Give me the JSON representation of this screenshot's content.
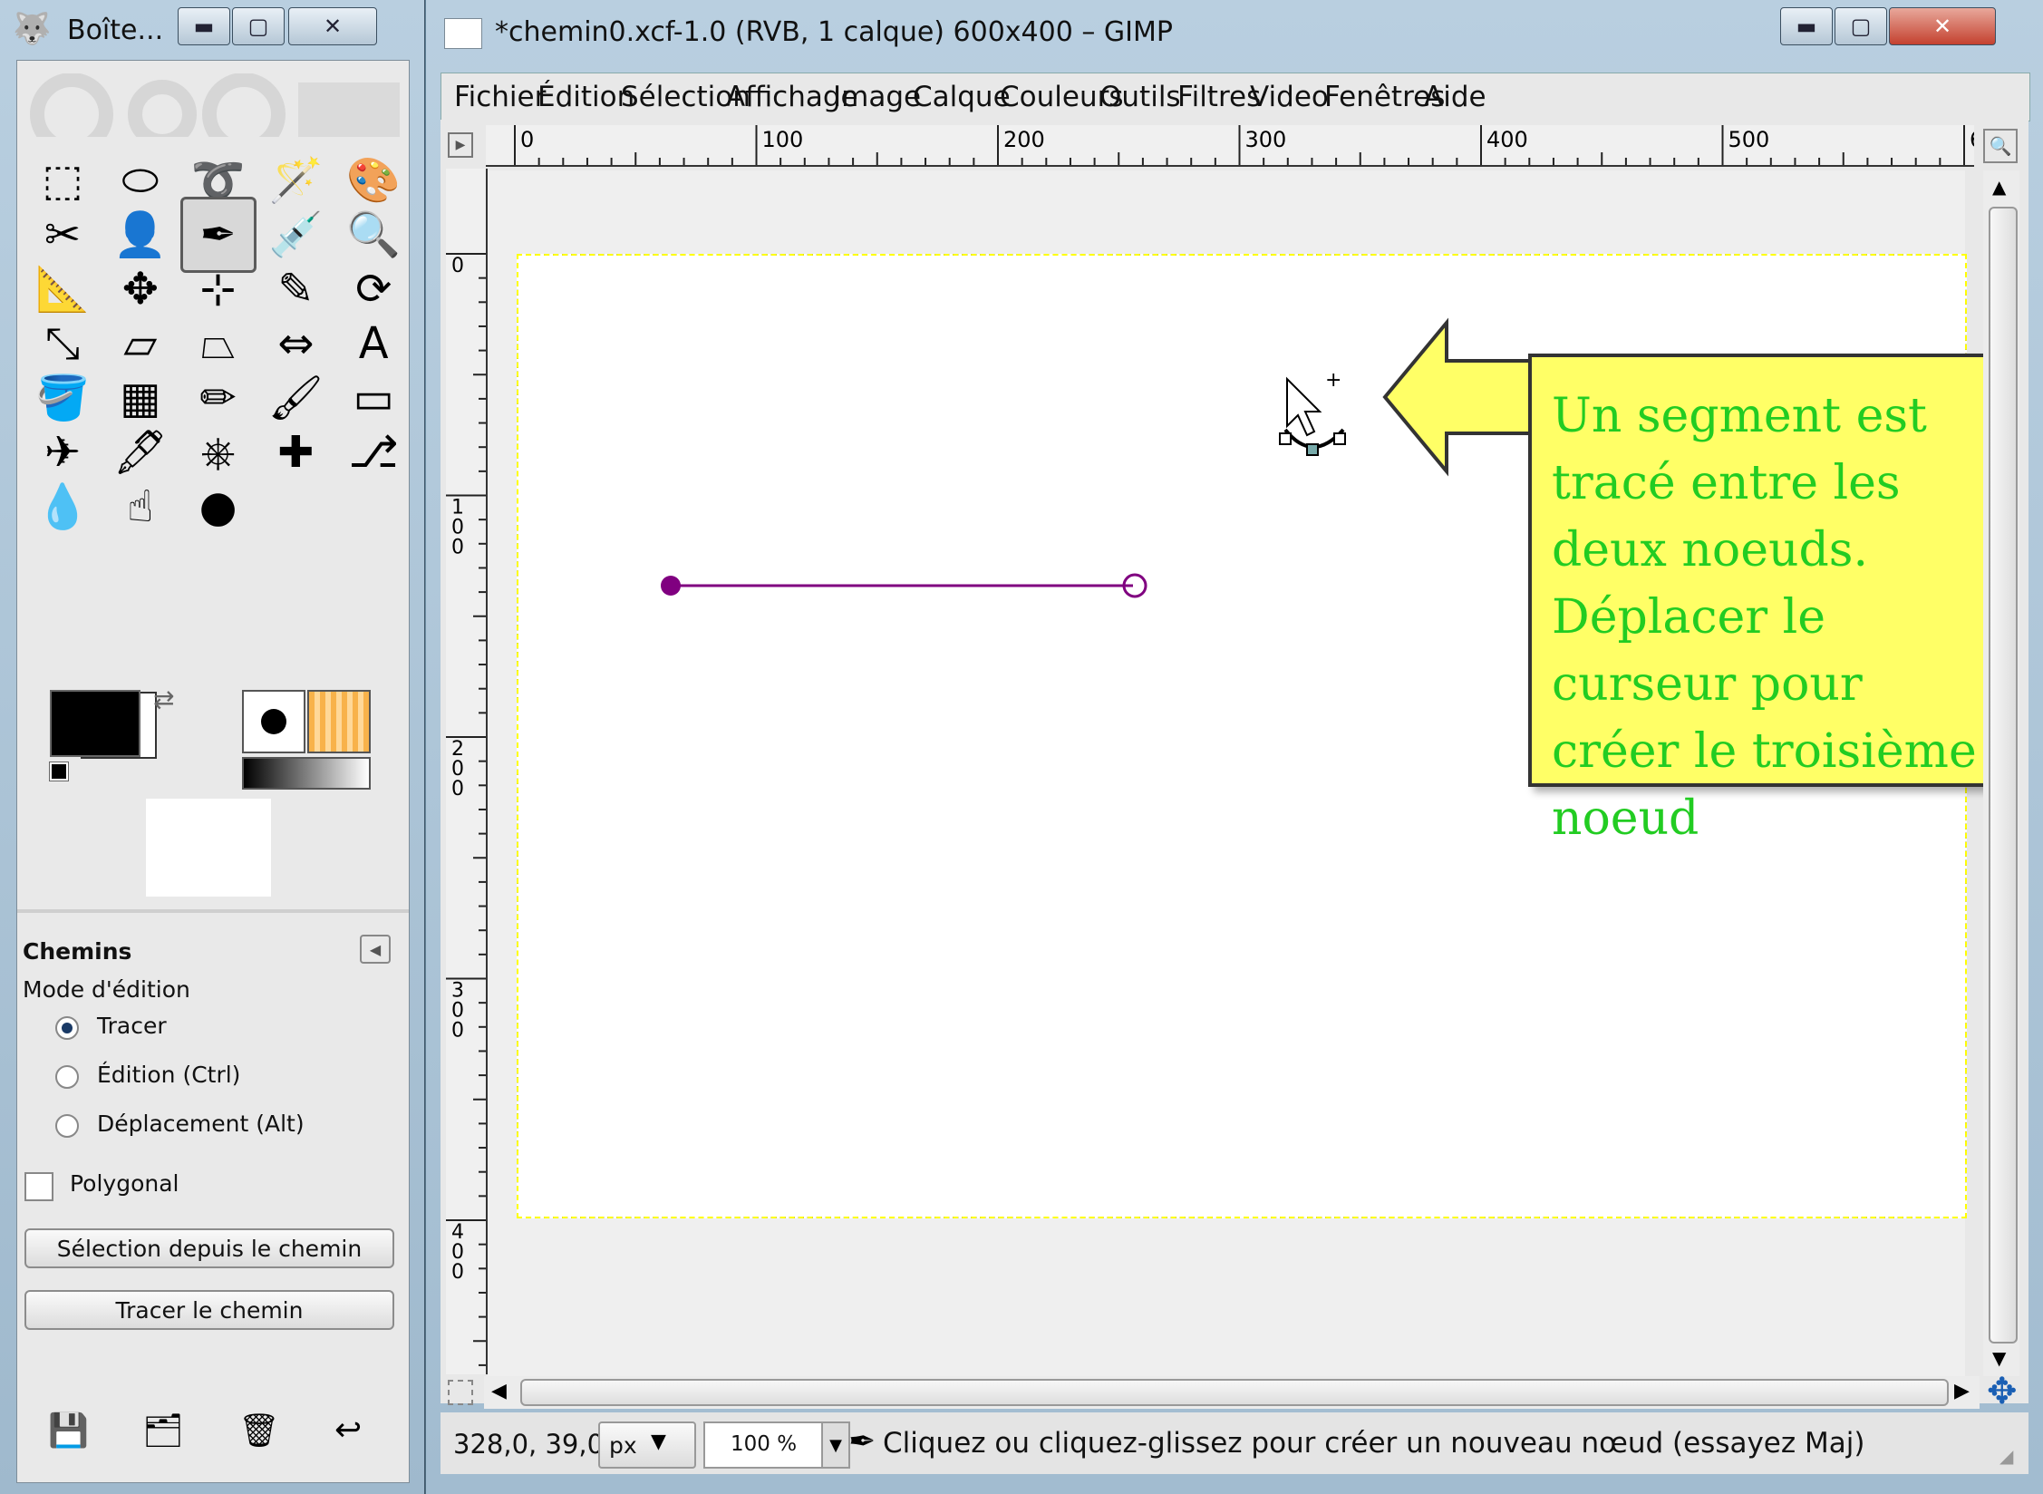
{
  "toolbox": {
    "title": "Boîte...",
    "tool_options_title": "Chemins",
    "edit_mode_label": "Mode d'édition",
    "modes": [
      {
        "label": "Tracer",
        "selected": true
      },
      {
        "label": "Édition (Ctrl)",
        "selected": false
      },
      {
        "label": "Déplacement (Alt)",
        "selected": false
      }
    ],
    "polygonal_label": "Polygonal",
    "polygonal_checked": false,
    "btn_selection": "Sélection depuis le chemin",
    "btn_stroke": "Tracer le chemin",
    "tools": [
      "rect-select",
      "ellipse-select",
      "free-select",
      "fuzzy-select",
      "color-select",
      "scissors",
      "foreground-select",
      "paths",
      "color-picker",
      "zoom",
      "measure",
      "move",
      "align",
      "crop",
      "rotate",
      "scale",
      "shear",
      "perspective",
      "flip",
      "text",
      "bucket-fill",
      "blend",
      "pencil",
      "paintbrush",
      "eraser",
      "airbrush",
      "ink",
      "clone",
      "heal",
      "perspective-clone",
      "blur",
      "smudge",
      "dodge-burn"
    ],
    "active_tool": "paths",
    "fg_color": "#000000",
    "bg_color": "#ffffff"
  },
  "main": {
    "title": "*chemin0.xcf-1.0 (RVB, 1 calque) 600x400 – GIMP",
    "menus": [
      "Fichier",
      "Édition",
      "Sélection",
      "Affichage",
      "Image",
      "Calque",
      "Couleurs",
      "Outils",
      "Filtres",
      "Video",
      "Fenêtres",
      "Aide"
    ],
    "hruler": [
      "0",
      "100",
      "200",
      "300",
      "400",
      "500",
      "6"
    ],
    "vruler": [
      "0",
      "100",
      "200",
      "300",
      "400"
    ],
    "callout": "Un segment est tracé entre les deux noeuds. Déplacer le curseur pour créer le troisième noeud",
    "callout_fill": "#ffff66",
    "callout_text_color": "#22cc22",
    "path_color": "#800080"
  },
  "status": {
    "coords": "328,0, 39,0",
    "unit": "px",
    "zoom": "100 %",
    "message": "Cliquez ou cliquez-glissez pour créer un nouveau nœud (essayez Maj)"
  }
}
